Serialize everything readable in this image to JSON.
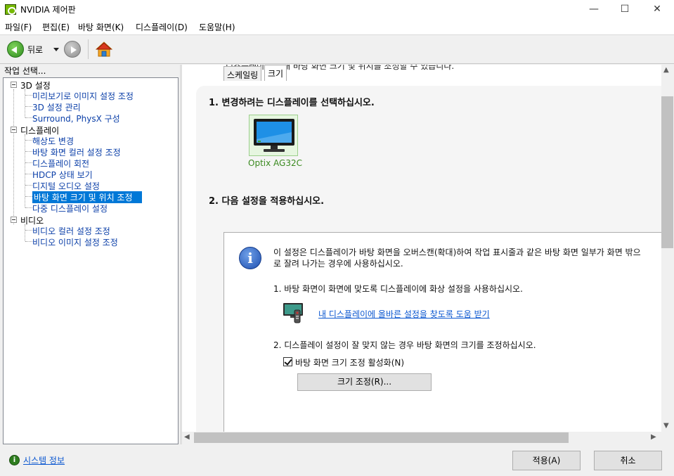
{
  "window": {
    "title": "NVIDIA 제어판",
    "minimize": "—",
    "maximize": "☐",
    "close": "✕"
  },
  "menu": [
    "파일(F)",
    "편집(E)",
    "바탕 화면(K)",
    "디스플레이(D)",
    "도움말(H)"
  ],
  "toolbar": {
    "back_label": "뒤로"
  },
  "left": {
    "header": "작업 선택...",
    "tree": [
      {
        "label": "3D 설정",
        "children": [
          "미리보기로 이미지 설정 조정",
          "3D 설정 관리",
          "Surround, PhysX 구성"
        ]
      },
      {
        "label": "디스플레이",
        "children": [
          "해상도 변경",
          "바탕 화면 컬러 설정 조정",
          "디스플레이 회전",
          "HDCP 상태 보기",
          "디지털 오디오 설정",
          "바탕 화면 크기 및 위치 조정",
          "다중 디스플레이 설정"
        ],
        "selected": "바탕 화면 크기 및 위치 조정"
      },
      {
        "label": "비디오",
        "children": [
          "비디오 컬러 설정 조정",
          "비디오 이미지 설정 조정"
        ]
      }
    ]
  },
  "main": {
    "cut_text": "디스플레이에 대해 바탕 화면 크기 및 위치를 조정할 수 있습니다.",
    "section1": "1. 변경하려는 디스플레이를 선택하십시오.",
    "monitor_label": "Optix AG32C",
    "section2": "2. 다음 설정을 적용하십시오.",
    "tabs": [
      "스케일링",
      "크기"
    ],
    "active_tab": "크기",
    "info_text": "이 설정은 디스플레이가 바탕 화면을 오버스캔(확대)하여 작업 표시줄과 같은 바탕 화면 일부가 화면 밖으로 잘려 나가는 경우에 사용하십시오.",
    "step1": "1. 바탕 화면이 화면에 맞도록 디스플레이에 화상 설정을 사용하십시오.",
    "help_link": "내 디스플레이에 올바른 설정을 찾도록 도움 받기",
    "step2": "2. 디스플레이 설정이 잘 맞지 않는 경우 바탕 화면의 크기를 조정하십시오.",
    "checkbox_label": "바탕 화면 크기 조정 활성화(N)",
    "checkbox_checked": true,
    "resize_button": "크기 조정(R)..."
  },
  "footer": {
    "sysinfo_link": "시스템 정보",
    "apply": "적용(A)",
    "cancel": "취소"
  },
  "colors": {
    "nvidia_green": "#76b900",
    "selection": "#0078d7",
    "link": "#0b57d0",
    "tree_text": "#0b3fa8"
  }
}
